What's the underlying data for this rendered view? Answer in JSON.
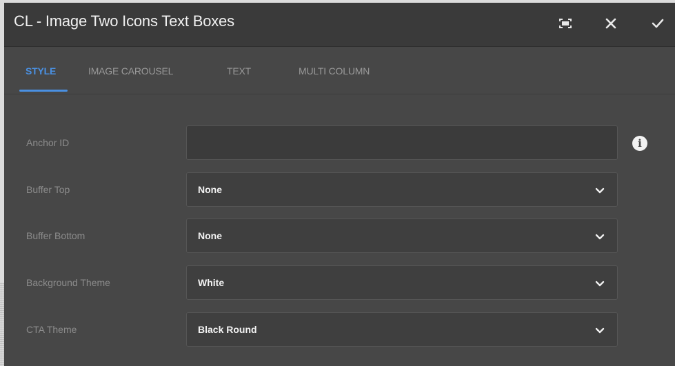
{
  "dialog": {
    "title": "CL - Image Two Icons Text Boxes",
    "toolbar_icons": [
      "fullscreen-icon",
      "close-icon",
      "checkmark-icon"
    ]
  },
  "tabs": [
    {
      "label": "STYLE",
      "active": true
    },
    {
      "label": "IMAGE CAROUSEL",
      "active": false
    },
    {
      "label": "TEXT",
      "active": false
    },
    {
      "label": "MULTI COLUMN",
      "active": false
    }
  ],
  "form": {
    "anchor_id": {
      "label": "Anchor ID",
      "value": ""
    },
    "buffer_top": {
      "label": "Buffer Top",
      "value": "None"
    },
    "buffer_bottom": {
      "label": "Buffer Bottom",
      "value": "None"
    },
    "background_theme": {
      "label": "Background Theme",
      "value": "White"
    },
    "cta_theme": {
      "label": "CTA Theme",
      "value": "Black Round"
    }
  },
  "colors": {
    "accent": "#4a90e2",
    "dialog_bg": "#474747",
    "titlebar_bg": "#3a3a3a"
  }
}
